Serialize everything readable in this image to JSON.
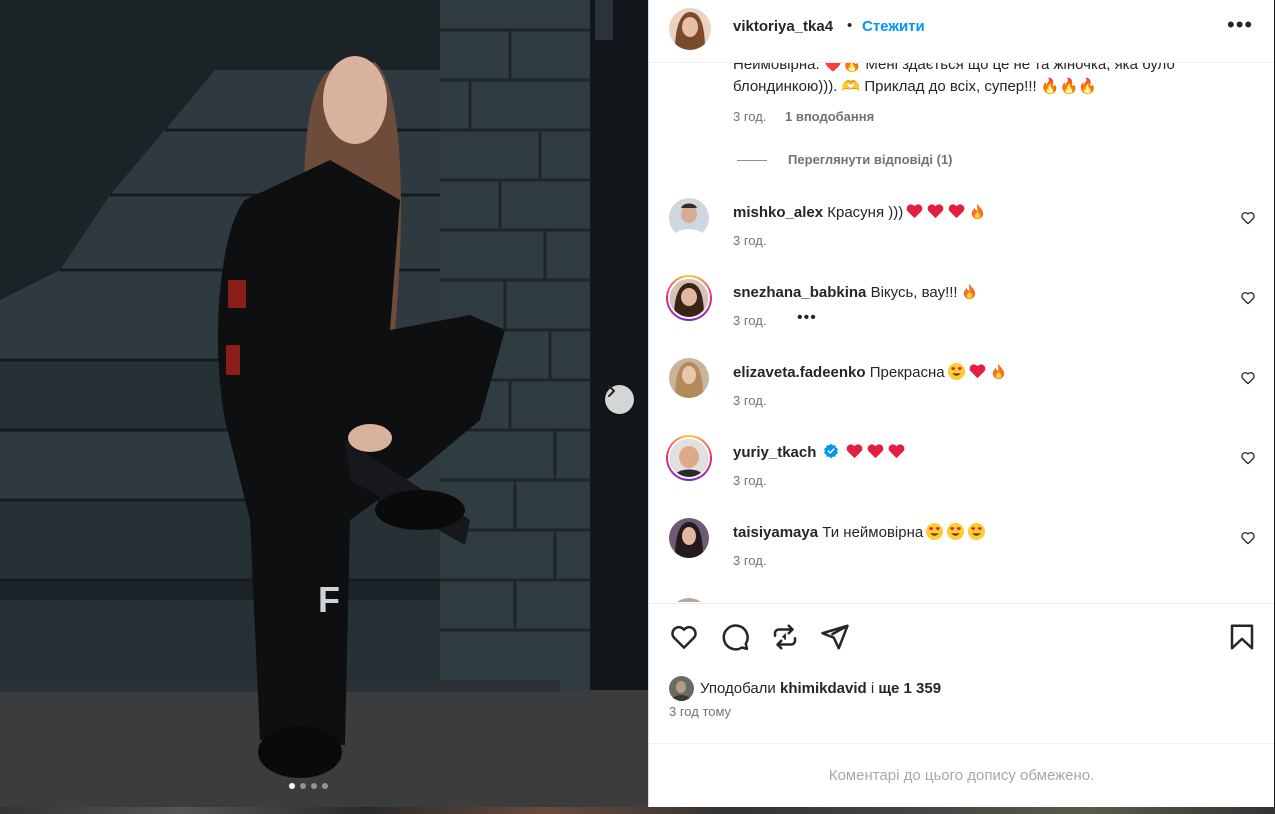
{
  "post": {
    "author": "viktoriya_tka4",
    "separator": "•",
    "follow_label": "Стежити",
    "more_label": "•••"
  },
  "caption": {
    "text": "Неймовірна. ❤️🔥 Мені здається що це не та жіночка, яка було блондинкою))). 🫶 Приклад до всіх, супер!!! 🔥🔥🔥",
    "time": "3 год.",
    "likes": "1 вподобання",
    "view_replies": "Переглянути відповіді (1)"
  },
  "comments": [
    {
      "user": "mishko_alex",
      "text": "Красуня )))",
      "time": "3 год.",
      "emojis": [
        "heart",
        "heart",
        "heart",
        "fire"
      ]
    },
    {
      "user": "snezhana_babkina",
      "text": "Вікусь, вау!!!",
      "time": "3 год.",
      "more": "•••",
      "emojis": [
        "fire"
      ]
    },
    {
      "user": "elizaveta.fadeenko",
      "text": "Прекрасна",
      "time": "3 год.",
      "emojis": [
        "hearteyes",
        "heart",
        "fire"
      ]
    },
    {
      "user": "yuriy_tkach",
      "text": "",
      "time": "3 год.",
      "verified": true,
      "emojis": [
        "heart",
        "heart",
        "heart"
      ]
    },
    {
      "user": "taisiyamaya",
      "text": "Ти неймовірна",
      "time": "3 год.",
      "emojis": [
        "hearteyes",
        "hearteyes",
        "hearteyes"
      ]
    }
  ],
  "likes_summary": {
    "prefix": "Уподобали",
    "user": "khimikdavid",
    "middle": "і",
    "rest": "ще 1 359"
  },
  "posted_ago": "3 год тому",
  "comments_limited": "Коментарі до цього допису обмежено.",
  "carousel": {
    "total": 4,
    "active": 0
  },
  "colors": {
    "accent": "#0095f6",
    "text": "#262626",
    "muted": "#737373",
    "heart_red": "#e41e3f"
  }
}
